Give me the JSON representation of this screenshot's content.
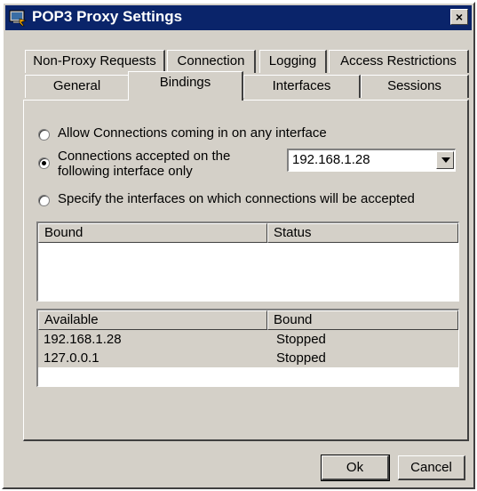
{
  "window": {
    "title": "POP3 Proxy Settings",
    "close_label": "×"
  },
  "tabs_row1": [
    {
      "label": "Non-Proxy Requests"
    },
    {
      "label": "Connection"
    },
    {
      "label": "Logging"
    },
    {
      "label": "Access Restrictions"
    }
  ],
  "tabs_row2": [
    {
      "label": "General"
    },
    {
      "label": "Bindings",
      "active": true
    },
    {
      "label": "Interfaces"
    },
    {
      "label": "Sessions"
    }
  ],
  "bindings": {
    "option_any": "Allow Connections coming in on any interface",
    "option_specific_line1": "Connections accepted on the",
    "option_specific_line2": "following interface only",
    "option_specify": "Specify the interfaces on which connections will be accepted",
    "selected_option": "specific",
    "interface_value": "192.168.1.28",
    "bound_list": {
      "col1": "Bound",
      "col2": "Status",
      "rows": []
    },
    "available_list": {
      "col1": "Available",
      "col2": "Bound",
      "rows": [
        {
          "address": "192.168.1.28",
          "state": "Stopped"
        },
        {
          "address": "127.0.0.1",
          "state": "Stopped"
        }
      ]
    }
  },
  "buttons": {
    "ok": "Ok",
    "cancel": "Cancel"
  },
  "colors": {
    "titlebar": "#0a246a",
    "face": "#d4d0c8"
  }
}
